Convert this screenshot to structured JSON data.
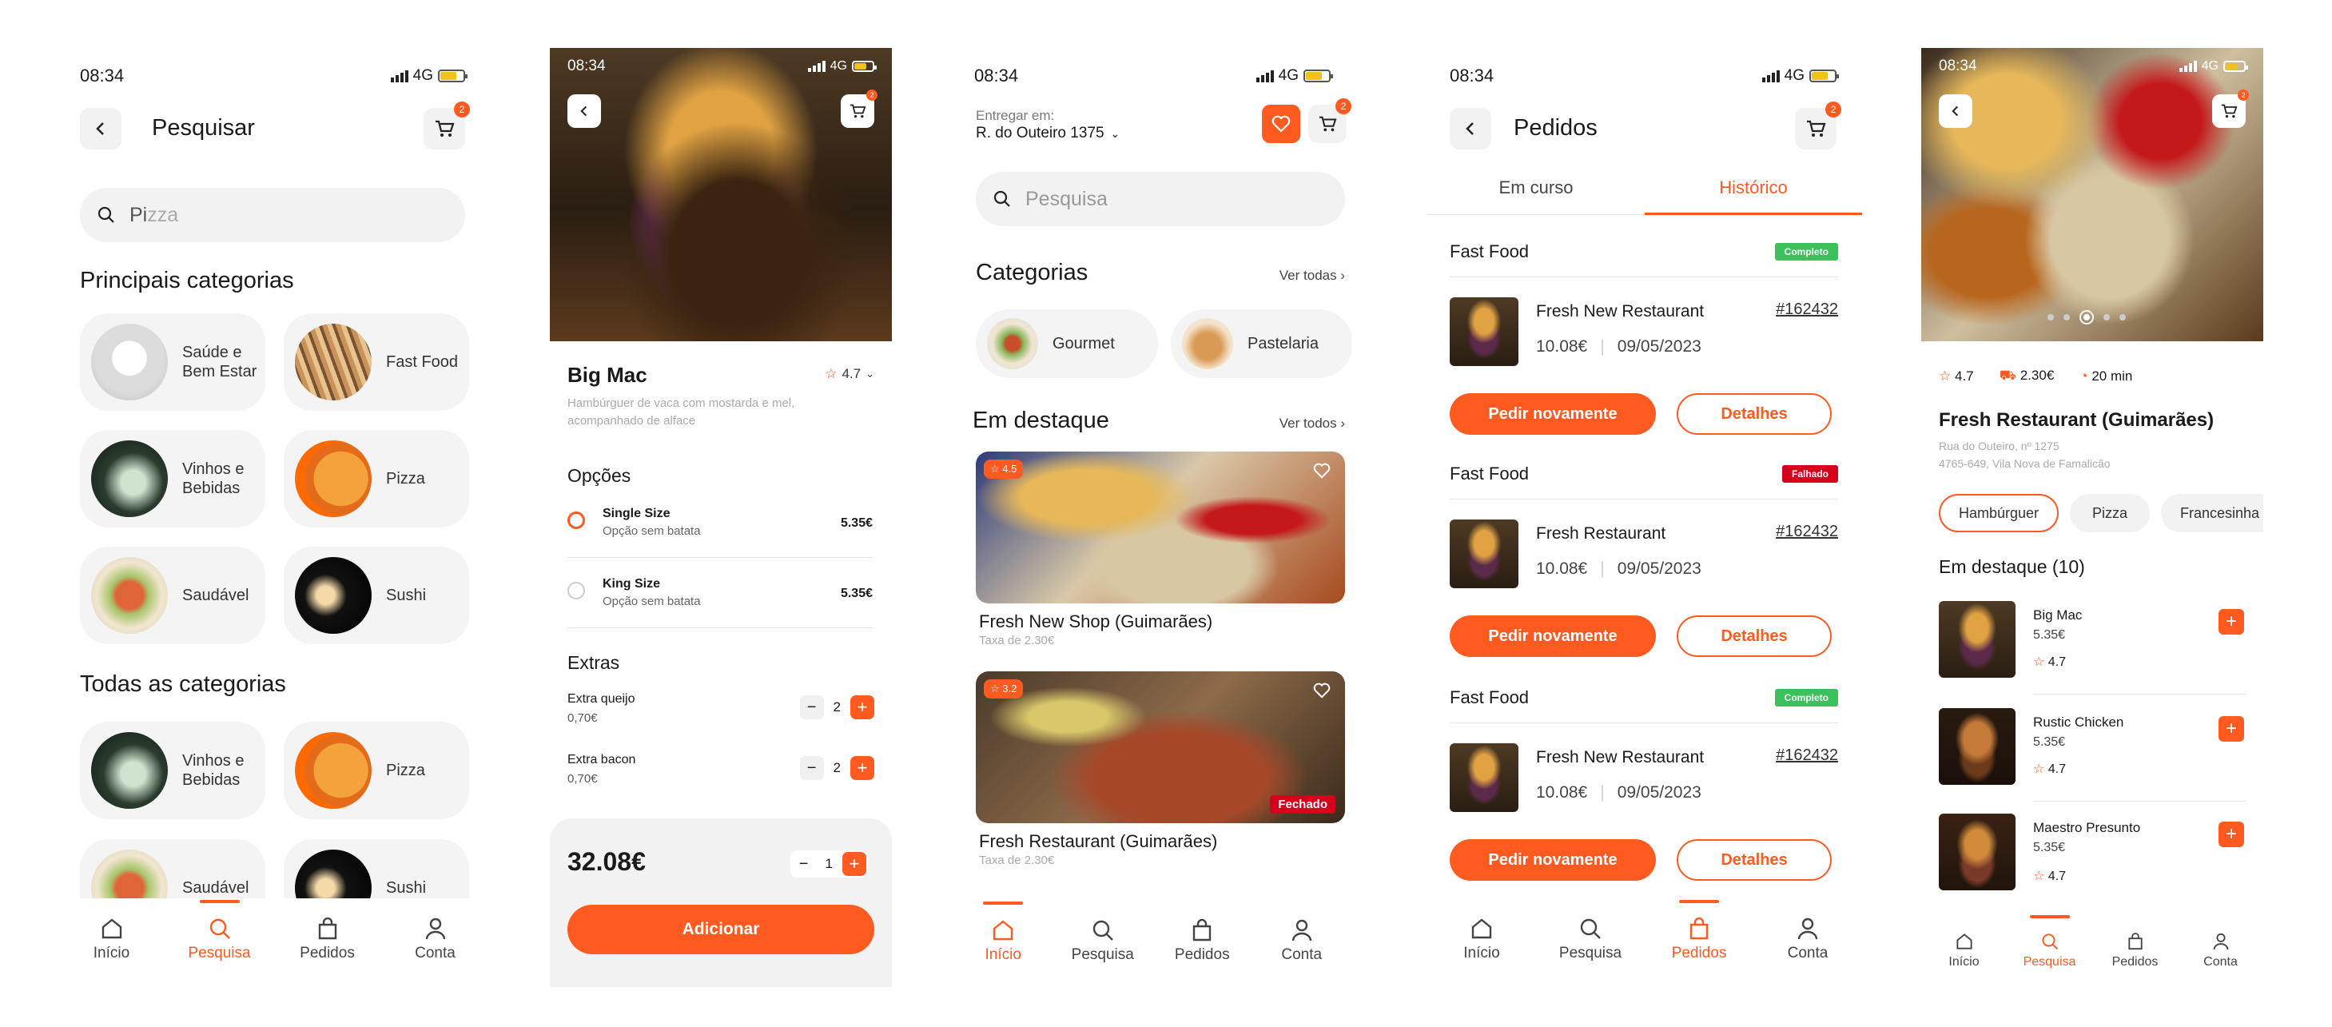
{
  "status": {
    "time": "08:34",
    "network": "4G"
  },
  "search_screen": {
    "title": "Pesquisar",
    "cart_count": "2",
    "search_value": "Pi",
    "search_placeholder": "zza",
    "main_heading": "Principais categorias",
    "main_categories": [
      "Saúde e Bem Estar",
      "Fast Food",
      "Vinhos e Bebidas",
      "Pizza",
      "Saudável",
      "Sushi"
    ],
    "all_heading": "Todas as categorias",
    "all_categories": [
      "Vinhos e Bebidas",
      "Pizza",
      "Saudável",
      "Sushi"
    ]
  },
  "product_screen": {
    "cart_count": "2",
    "name": "Big Mac",
    "rating": "4.7",
    "description": "Hambúrguer de vaca com mostarda e mel, acompanhado de alface",
    "options_heading": "Opções",
    "options": [
      {
        "name": "Single Size",
        "sub": "Opção sem batata",
        "price": "5.35€"
      },
      {
        "name": "King Size",
        "sub": "Opção sem batata",
        "price": "5.35€"
      }
    ],
    "extras_heading": "Extras",
    "extras": [
      {
        "name": "Extra queijo",
        "price": "0,70€",
        "qty": "2"
      },
      {
        "name": "Extra bacon",
        "price": "0,70€",
        "qty": "2"
      }
    ],
    "total": "32.08€",
    "qty": "1",
    "add_label": "Adicionar"
  },
  "home_screen": {
    "deliver_label": "Entregar em:",
    "address": "R. do Outeiro 1375",
    "cart_count": "2",
    "search_placeholder": "Pesquisa",
    "categories_heading": "Categorias",
    "see_all_categories": "Ver todas",
    "categories": [
      "Gourmet",
      "Pastelaria"
    ],
    "featured_heading": "Em destaque",
    "see_all_featured": "Ver todos",
    "featured": [
      {
        "name": "Fresh New Shop (Guimarães)",
        "fee": "Taxa de 2.30€",
        "rating": "4.5",
        "closed": ""
      },
      {
        "name": "Fresh Restaurant (Guimarães)",
        "fee": "Taxa de 2.30€",
        "rating": "3.2",
        "closed": "Fechado"
      }
    ]
  },
  "orders_screen": {
    "title": "Pedidos",
    "cart_count": "2",
    "tabs": [
      "Em curso",
      "Histórico"
    ],
    "orders": [
      {
        "category": "Fast Food",
        "status": "Completo",
        "status_color": "#3cc05b",
        "restaurant": "Fresh New Restaurant",
        "id": "#162432",
        "price": "10.08€",
        "date": "09/05/2023"
      },
      {
        "category": "Fast Food",
        "status": "Falhado",
        "status_color": "#d6001c",
        "restaurant": "Fresh Restaurant",
        "id": "#162432",
        "price": "10.08€",
        "date": "09/05/2023"
      },
      {
        "category": "Fast Food",
        "status": "Completo",
        "status_color": "#3cc05b",
        "restaurant": "Fresh New Restaurant",
        "id": "#162432",
        "price": "10.08€",
        "date": "09/05/2023"
      }
    ],
    "reorder_label": "Pedir novamente",
    "details_label": "Detalhes"
  },
  "restaurant_screen": {
    "cart_count": "2",
    "rating": "4.7",
    "delivery_fee": "2.30€",
    "time": "20 min",
    "name": "Fresh Restaurant (Guimarães)",
    "address1": "Rua do Outeiro, nº 1275",
    "address2": "4765-649, Vila Nova de Famalicão",
    "chips": [
      "Hambúrguer",
      "Pizza",
      "Francesinha"
    ],
    "featured_heading": "Em destaque (10)",
    "items": [
      {
        "name": "Big Mac",
        "price": "5.35€",
        "rating": "4.7"
      },
      {
        "name": "Rustic Chicken",
        "price": "5.35€",
        "rating": "4.7"
      },
      {
        "name": "Maestro Presunto",
        "price": "5.35€",
        "rating": "4.7"
      }
    ]
  },
  "tabbar": {
    "home": "Início",
    "search": "Pesquisa",
    "orders": "Pedidos",
    "account": "Conta"
  },
  "colors": {
    "accent": "#ff5a1f",
    "complete": "#3cc05b",
    "failed": "#d6001c"
  }
}
